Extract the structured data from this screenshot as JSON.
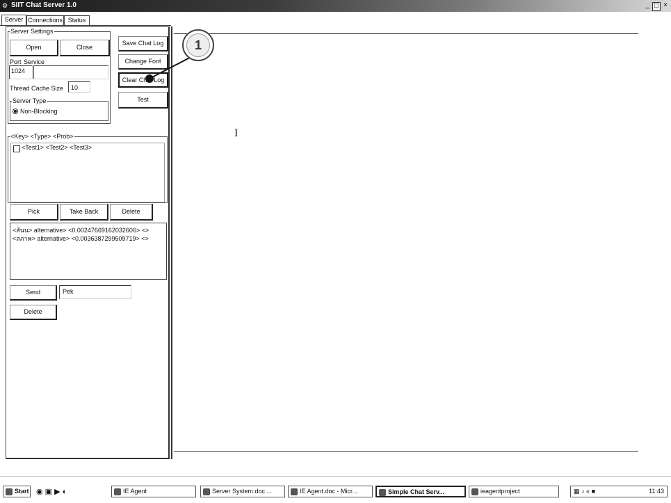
{
  "window": {
    "title": "SIIT Chat Server 1.0",
    "min": "_",
    "max": "□",
    "close": "×"
  },
  "tabs": [
    "Server",
    "Connections",
    "Status"
  ],
  "server_settings": {
    "legend": "Server Settings",
    "open_label": "Open",
    "close_label": "Close",
    "port_label": "Port",
    "service_label": "Service",
    "port_value": "1024",
    "service_value": "",
    "thread_cache_label": "Thread Cache Size",
    "thread_cache_value": "10",
    "server_type_legend": "Server Type",
    "server_type_option": "Non-Blocking"
  },
  "actions": {
    "save_chat_log": "Save Chat Log",
    "change_font": "Change Font",
    "clear_chat_log": "Clear Chat Log",
    "test": "Test"
  },
  "callout": {
    "number": "1"
  },
  "key_list": {
    "legend": "<Key> <Type> <Prob>",
    "items": [
      "<Test1> <Test2> <Test3>"
    ],
    "pick_label": "Pick",
    "take_back_label": "Take Back",
    "delete_label": "Delete"
  },
  "alternatives": [
    "<สันน> alternative> <0.00247669162032606> <>",
    "<สภาพ> alternative> <0.0036387299509719> <>"
  ],
  "send": {
    "send_label": "Send",
    "message_value": "Pek",
    "delete_label": "Delete"
  },
  "taskbar": {
    "start_label": "Start",
    "tasks": [
      "IE Agent",
      "Server System.doc ...",
      "IE Agent.doc - Micr...",
      "Simple Chat Serv...",
      "ieagentproject"
    ],
    "active_index": 3,
    "clock": "11:43"
  }
}
